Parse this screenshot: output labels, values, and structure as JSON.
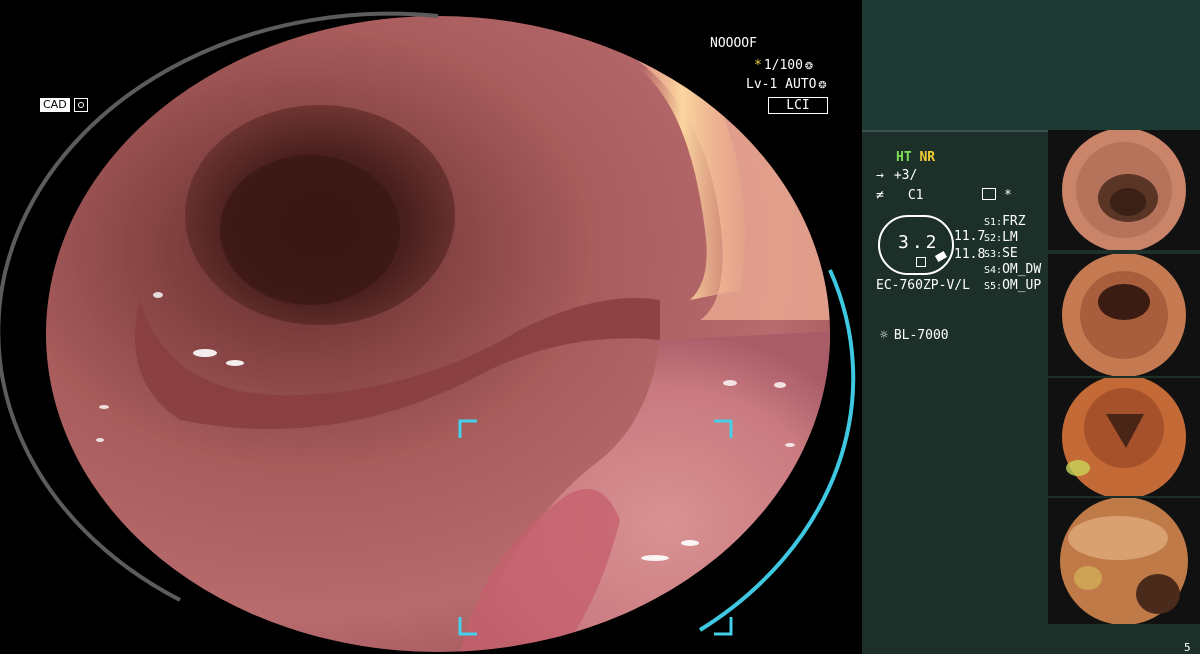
{
  "main": {
    "cad_label": "CAD",
    "top_code": "NOOOOF",
    "shutter": "1/100",
    "level": "Lv-1 AUTO",
    "mode": "LCI"
  },
  "side": {
    "ht": "HT",
    "nr": "NR",
    "enhance": "+3/",
    "color": "C1",
    "asterisk": "*",
    "zoom": "3.2",
    "val1": "11.7",
    "val2": "11.8",
    "scope_model": "EC-760ZP-V/L",
    "light_source": "BL-7000",
    "switches": [
      {
        "key": "S1:",
        "label": "FRZ"
      },
      {
        "key": "S2:",
        "label": "LM"
      },
      {
        "key": "S3:",
        "label": "SE"
      },
      {
        "key": "S4:",
        "label": "OM_DW"
      },
      {
        "key": "S5:",
        "label": "OM_UP"
      }
    ],
    "page_num": "5"
  },
  "colors": {
    "side_bg": "#1c3029",
    "ht": "#7ee05a",
    "nr": "#f2cf35",
    "cad_bracket": "#43d0e8",
    "mucosa": "#b56a6a"
  }
}
